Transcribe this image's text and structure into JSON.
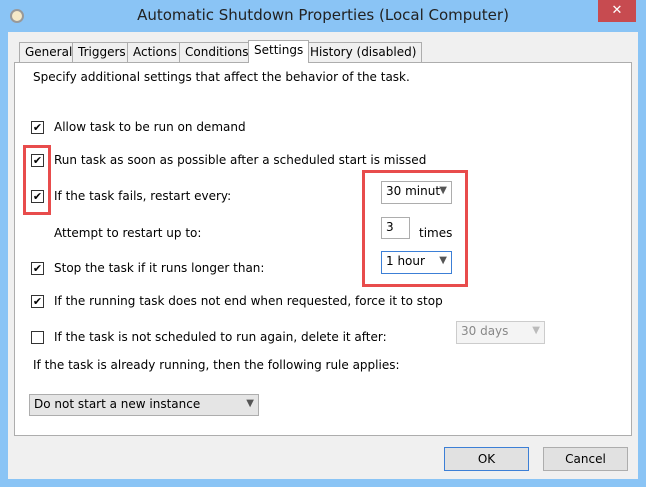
{
  "window": {
    "title": "Automatic Shutdown Properties (Local Computer)",
    "close": "✕"
  },
  "tabs": [
    "General",
    "Triggers",
    "Actions",
    "Conditions",
    "Settings",
    "History (disabled)"
  ],
  "settings": {
    "intro": "Specify additional settings that affect the behavior of the task.",
    "allow_on_demand": {
      "label": "Allow task to be run on demand",
      "checked": true
    },
    "run_asap": {
      "label": "Run task as soon as possible after a scheduled start is missed",
      "checked": true
    },
    "restart_every": {
      "label": "If the task fails, restart every:",
      "checked": true,
      "value": "30 minut"
    },
    "restart_attempts": {
      "label": "Attempt to restart up to:",
      "value": "3",
      "suffix": "times"
    },
    "stop_longer": {
      "label": "Stop the task if it runs longer than:",
      "checked": true,
      "value": "1 hour"
    },
    "force_stop": {
      "label": "If the running task does not end when requested, force it to stop",
      "checked": true
    },
    "delete_after": {
      "label": "If the task is not scheduled to run again, delete it after:",
      "checked": false,
      "value": "30 days"
    },
    "rule_label": "If the task is already running, then the following rule applies:",
    "rule_value": "Do not start a new instance"
  },
  "buttons": {
    "ok": "OK",
    "cancel": "Cancel"
  },
  "check_glyph": "✔"
}
